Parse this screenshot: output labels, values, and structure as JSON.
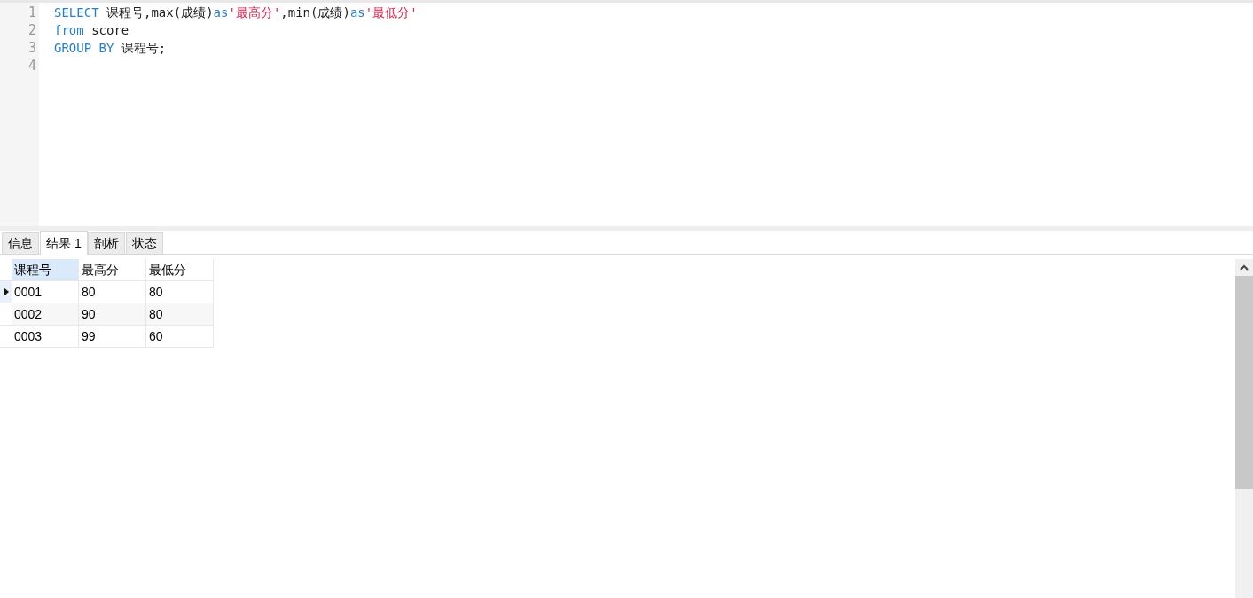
{
  "editor": {
    "lines": [
      {
        "number": "1",
        "tokens": [
          {
            "kind": "keyword",
            "text": "SELECT"
          },
          {
            "kind": "plain",
            "text": " 课程号,max(成绩)"
          },
          {
            "kind": "keyword",
            "text": "as"
          },
          {
            "kind": "string",
            "text": "'最高分'"
          },
          {
            "kind": "plain",
            "text": ",min(成绩)"
          },
          {
            "kind": "keyword",
            "text": "as"
          },
          {
            "kind": "string",
            "text": "'最低分'"
          }
        ]
      },
      {
        "number": "2",
        "tokens": [
          {
            "kind": "keyword",
            "text": "from"
          },
          {
            "kind": "plain",
            "text": " score"
          }
        ]
      },
      {
        "number": "3",
        "tokens": [
          {
            "kind": "keyword",
            "text": "GROUP BY"
          },
          {
            "kind": "plain",
            "text": " 课程号;"
          }
        ]
      },
      {
        "number": "4"
      }
    ]
  },
  "tabs": [
    {
      "label": "信息",
      "selected": false
    },
    {
      "label": "结果 1",
      "selected": true
    },
    {
      "label": "剖析",
      "selected": false
    },
    {
      "label": "状态",
      "selected": false
    }
  ],
  "table": {
    "columns": [
      "课程号",
      "最高分",
      "最低分"
    ],
    "rows": [
      {
        "selected": true,
        "cells": [
          "0001",
          "80",
          "80"
        ]
      },
      {
        "selected": false,
        "cells": [
          "0002",
          "90",
          "80"
        ]
      },
      {
        "selected": false,
        "cells": [
          "0003",
          "99",
          "60"
        ]
      }
    ]
  }
}
